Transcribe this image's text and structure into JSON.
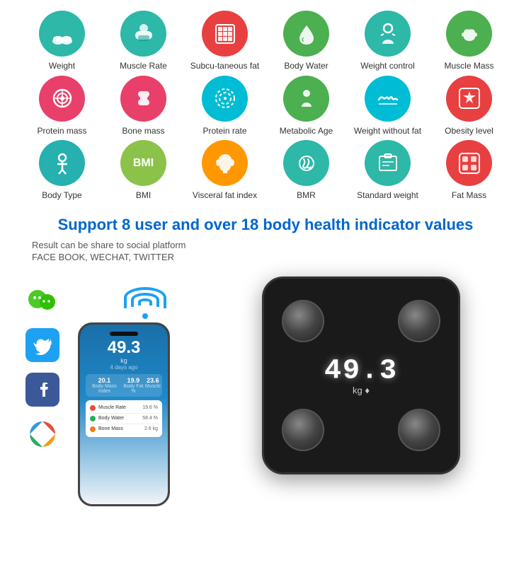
{
  "icons_row1": [
    {
      "id": "weight",
      "label": "Weight",
      "color": "teal",
      "icon": "👣",
      "emoji": "👣"
    },
    {
      "id": "muscle-rate",
      "label": "Muscle Rate",
      "color": "teal",
      "icon": "💪",
      "emoji": "🦾"
    },
    {
      "id": "subcu-fat",
      "label": "Subcu-taneous fat",
      "color": "red",
      "icon": "🔲",
      "emoji": "🟥"
    },
    {
      "id": "body-water",
      "label": "Body Water",
      "color": "green",
      "icon": "💧",
      "emoji": "💧"
    },
    {
      "id": "weight-control",
      "label": "Weight control",
      "color": "teal",
      "icon": "⚖️",
      "emoji": "🚶"
    },
    {
      "id": "muscle-mass",
      "label": "Muscle Mass",
      "color": "green",
      "icon": "💪",
      "emoji": "💪"
    }
  ],
  "icons_row2": [
    {
      "id": "protein-mass",
      "label": "Protein mass",
      "color": "pink",
      "icon": "🧬",
      "emoji": "🌐"
    },
    {
      "id": "bone-mass",
      "label": "Bone mass",
      "color": "pink",
      "icon": "🦴",
      "emoji": "🦴"
    },
    {
      "id": "protein-rate",
      "label": "Protein rate",
      "color": "cyan",
      "icon": "⭕",
      "emoji": "⭕"
    },
    {
      "id": "metabolic-age",
      "label": "Metabolic Age",
      "color": "green",
      "icon": "🧑",
      "emoji": "🚶"
    },
    {
      "id": "weight-without-fat",
      "label": "Weight without fat",
      "color": "cyan",
      "icon": "〰️",
      "emoji": "〰️"
    },
    {
      "id": "obesity-level",
      "label": "Obesity level",
      "color": "red",
      "icon": "⭐",
      "emoji": "⭐"
    }
  ],
  "icons_row3": [
    {
      "id": "body-type",
      "label": "Body Type",
      "color": "teal",
      "icon": "🧑",
      "emoji": "🧑"
    },
    {
      "id": "bmi",
      "label": "BMI",
      "color": "light-green",
      "icon": "BMI",
      "emoji": "BMI"
    },
    {
      "id": "visceral-fat",
      "label": "Visceral fat index",
      "color": "orange",
      "icon": "🫁",
      "emoji": "🫁"
    },
    {
      "id": "bmr",
      "label": "BMR",
      "color": "teal",
      "icon": "🔥",
      "emoji": "🔥"
    },
    {
      "id": "standard-weight",
      "label": "Standard weight",
      "color": "teal",
      "icon": "📋",
      "emoji": "📋"
    },
    {
      "id": "fat-mass",
      "label": "Fat Mass",
      "color": "red",
      "icon": "🟫",
      "emoji": "🟫"
    }
  ],
  "support": {
    "title": "Support 8 user and over 18 body health indicator values",
    "share_text": "Result can be share to social platform",
    "platforms": "FACE BOOK, WECHAT, TWITTER"
  },
  "scale": {
    "display": "49.3",
    "unit": "kg ♦"
  },
  "phone": {
    "weight": "49.3",
    "unit": "kg",
    "sublabel": "4 days ago",
    "stats": [
      {
        "value": "20.1",
        "label": "Body Mass Index"
      },
      {
        "value": "19.9",
        "label": "Body Fat %"
      },
      {
        "value": "23.6",
        "label": "Muscle"
      }
    ],
    "list_items": [
      {
        "label": "Muscle Rate",
        "value": "19.6 %",
        "color": "#e74c3c"
      },
      {
        "label": "Body Water",
        "value": "58.4 %",
        "color": "#27ae60"
      },
      {
        "label": "Bone Mass",
        "value": "2.6 kg",
        "color": "#e67e22"
      }
    ]
  },
  "social": {
    "wechat_label": "WeChat",
    "twitter_label": "Twitter",
    "facebook_label": "Facebook",
    "color_wheel_label": "Color Wheel"
  }
}
